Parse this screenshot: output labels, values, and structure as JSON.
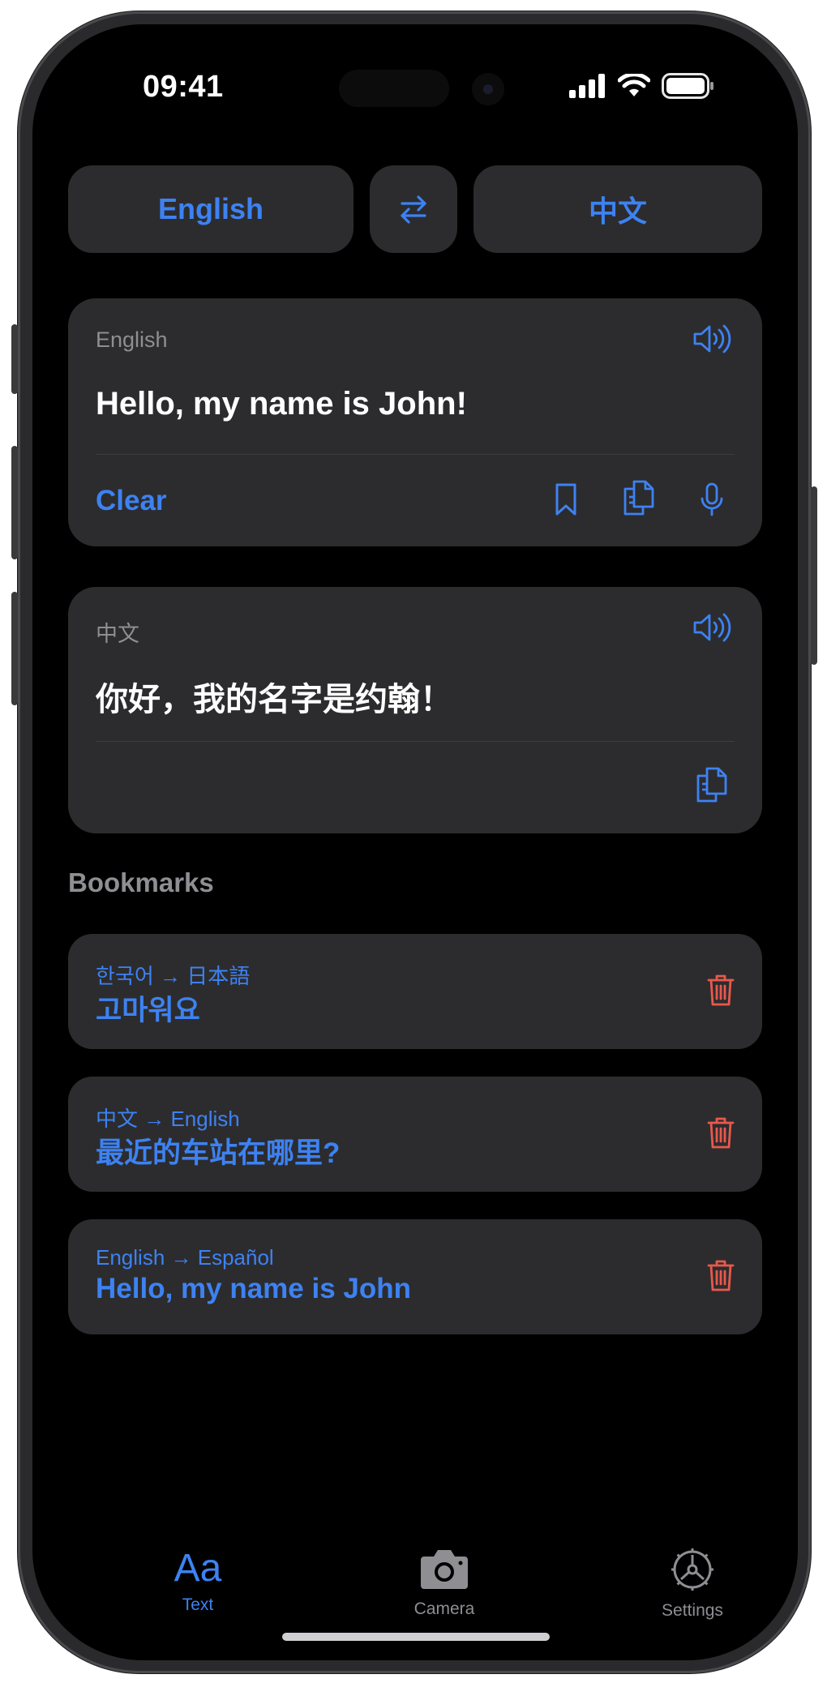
{
  "status_bar": {
    "time": "09:41"
  },
  "language_bar": {
    "source": "English",
    "target": "中文"
  },
  "input_card": {
    "language": "English",
    "text": "Hello, my name is John!",
    "clear_label": "Clear"
  },
  "output_card": {
    "language": "中文",
    "text": "你好，我的名字是约翰！"
  },
  "bookmarks": {
    "title": "Bookmarks",
    "items": [
      {
        "pair": "한국어 → 日本語",
        "phrase": "고마워요"
      },
      {
        "pair": "中文 → English",
        "phrase": "最近的车站在哪里?"
      },
      {
        "pair": "English → Español",
        "phrase": "Hello, my name is John"
      }
    ]
  },
  "tab_bar": {
    "tabs": [
      {
        "glyph": "Aa",
        "label": "Text",
        "icon": "text-icon",
        "active": true
      },
      {
        "label": "Camera",
        "icon": "camera-icon",
        "active": false
      },
      {
        "label": "Settings",
        "icon": "gear-icon",
        "active": false
      }
    ]
  },
  "colors": {
    "accent": "#3d82f2",
    "destructive": "#e8594c",
    "card": "#2c2c2e",
    "background": "#000000",
    "secondary_text": "#8e8e93"
  }
}
